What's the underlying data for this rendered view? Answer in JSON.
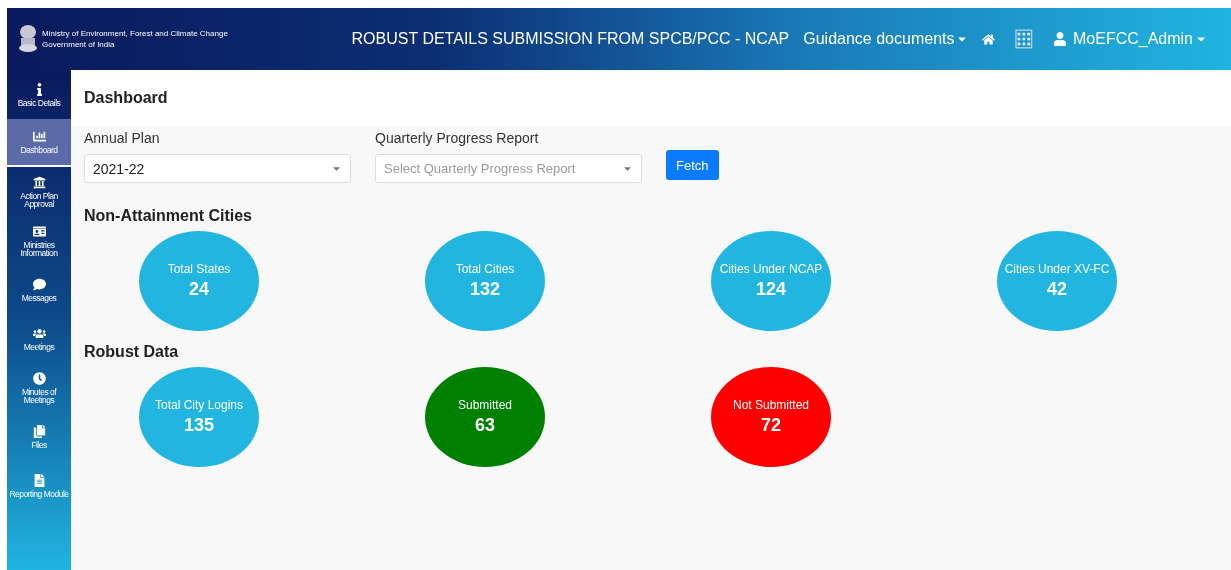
{
  "header": {
    "org_name": "Ministry of Environment, Forest and Climate Change",
    "org_sub": "Government of India",
    "title": "ROBUST DETAILS SUBMISSION FROM SPCB/PCC - NCAP",
    "nav_dropdown": "Guidance documents",
    "user": "MoEFCC_Admin"
  },
  "sidebar": {
    "items": [
      {
        "label": "Basic Details",
        "selected": false
      },
      {
        "label": "Dashboard",
        "selected": true
      },
      {
        "label": "Action Plan Approval",
        "selected": false
      },
      {
        "label": "Ministries Information",
        "selected": false
      },
      {
        "label": "Messages",
        "selected": false
      },
      {
        "label": "Meetings",
        "selected": false
      },
      {
        "label": "Minutes of Meetings",
        "selected": false
      },
      {
        "label": "Files",
        "selected": false
      },
      {
        "label": "Reporting Module",
        "selected": false
      }
    ]
  },
  "page_title": "Dashboard",
  "filters": [
    {
      "label": "Annual Plan",
      "value": "2021-22"
    },
    {
      "label": "Quarterly Progress Report",
      "placeholder": "Select Quarterly Progress Report"
    }
  ],
  "fetch_button": "Fetch",
  "sections": [
    {
      "title": "Non-Attainment Cities",
      "stats": [
        {
          "label": "Total States",
          "value": "24",
          "color": "#22b5e0"
        },
        {
          "label": "Total Cities",
          "value": "132",
          "color": "#22b5e0"
        },
        {
          "label": "Cities Under NCAP",
          "value": "124",
          "color": "#22b5e0"
        },
        {
          "label": "Cities Under XV-FC",
          "value": "42",
          "color": "#22b5e0"
        }
      ]
    },
    {
      "title": "Robust Data",
      "stats": [
        {
          "label": "Total City Logins",
          "value": "135",
          "color": "#22b5e0"
        },
        {
          "label": "Submitted",
          "value": "63",
          "color": "#008000"
        },
        {
          "label": "Not Submitted",
          "value": "72",
          "color": "#ff0000"
        }
      ]
    }
  ]
}
